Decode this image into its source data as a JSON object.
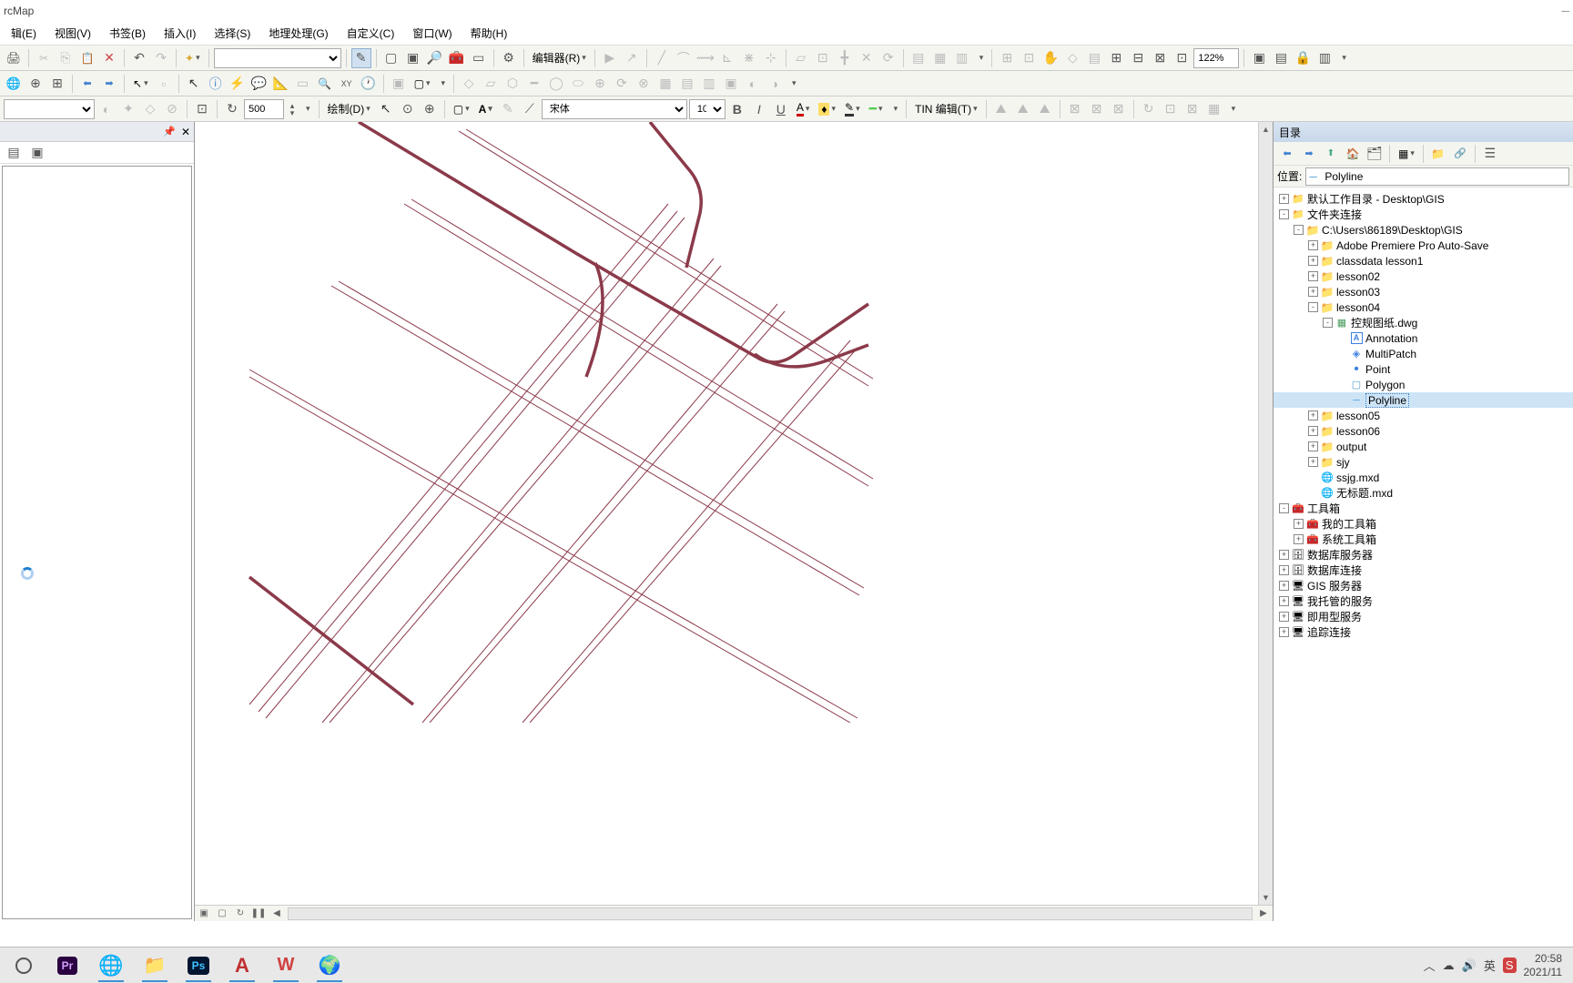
{
  "app_title": "rcMap",
  "menus": [
    "辑(E)",
    "视图(V)",
    "书签(B)",
    "插入(I)",
    "选择(S)",
    "地理处理(G)",
    "自定义(C)",
    "窗口(W)",
    "帮助(H)"
  ],
  "scale_value": "500",
  "draw_label": "绘制(D)",
  "editor_label": "编辑器(R)",
  "tin_label": "TIN 编辑(T)",
  "font_name": "宋体",
  "font_size": "10",
  "zoom_pct": "122%",
  "catalog": {
    "title": "目录",
    "location_label": "位置:",
    "location_value": "Polyline",
    "tree": [
      {
        "depth": 0,
        "toggle": "+",
        "icon": "home-folder",
        "label": "默认工作目录 - Desktop\\GIS"
      },
      {
        "depth": 0,
        "toggle": "-",
        "icon": "conn-folder",
        "label": "文件夹连接"
      },
      {
        "depth": 1,
        "toggle": "-",
        "icon": "folder-icon",
        "label": "C:\\Users\\86189\\Desktop\\GIS"
      },
      {
        "depth": 2,
        "toggle": "+",
        "icon": "folder-icon",
        "label": "Adobe Premiere Pro Auto-Save"
      },
      {
        "depth": 2,
        "toggle": "+",
        "icon": "folder-icon",
        "label": "classdata lesson1"
      },
      {
        "depth": 2,
        "toggle": "+",
        "icon": "folder-icon",
        "label": "lesson02"
      },
      {
        "depth": 2,
        "toggle": "+",
        "icon": "folder-icon",
        "label": "lesson03"
      },
      {
        "depth": 2,
        "toggle": "-",
        "icon": "folder-icon",
        "label": "lesson04"
      },
      {
        "depth": 3,
        "toggle": "-",
        "icon": "dwg-icon",
        "label": "控规图纸.dwg"
      },
      {
        "depth": 4,
        "toggle": "",
        "icon": "anno-icon",
        "label": "Annotation"
      },
      {
        "depth": 4,
        "toggle": "",
        "icon": "multi-icon",
        "label": "MultiPatch"
      },
      {
        "depth": 4,
        "toggle": "",
        "icon": "point-icon",
        "label": "Point"
      },
      {
        "depth": 4,
        "toggle": "",
        "icon": "poly-icon",
        "label": "Polygon"
      },
      {
        "depth": 4,
        "toggle": "",
        "icon": "line-icon",
        "label": "Polyline",
        "selected": true
      },
      {
        "depth": 2,
        "toggle": "+",
        "icon": "folder-icon",
        "label": "lesson05"
      },
      {
        "depth": 2,
        "toggle": "+",
        "icon": "folder-icon",
        "label": "lesson06"
      },
      {
        "depth": 2,
        "toggle": "+",
        "icon": "folder-icon",
        "label": "output"
      },
      {
        "depth": 2,
        "toggle": "+",
        "icon": "folder-icon",
        "label": "sjy"
      },
      {
        "depth": 2,
        "toggle": "",
        "icon": "mxd-icon",
        "label": "ssjg.mxd"
      },
      {
        "depth": 2,
        "toggle": "",
        "icon": "mxd-icon",
        "label": "无标题.mxd"
      },
      {
        "depth": 0,
        "toggle": "-",
        "icon": "toolbox-icon",
        "label": "工具箱"
      },
      {
        "depth": 1,
        "toggle": "+",
        "icon": "toolbox-icon",
        "label": "我的工具箱"
      },
      {
        "depth": 1,
        "toggle": "+",
        "icon": "toolbox-icon",
        "label": "系统工具箱"
      },
      {
        "depth": 0,
        "toggle": "+",
        "icon": "db-icon",
        "label": "数据库服务器"
      },
      {
        "depth": 0,
        "toggle": "+",
        "icon": "db-icon",
        "label": "数据库连接"
      },
      {
        "depth": 0,
        "toggle": "+",
        "icon": "server-icon",
        "label": "GIS 服务器"
      },
      {
        "depth": 0,
        "toggle": "+",
        "icon": "server-icon",
        "label": "我托管的服务"
      },
      {
        "depth": 0,
        "toggle": "+",
        "icon": "server-icon",
        "label": "即用型服务"
      },
      {
        "depth": 0,
        "toggle": "+",
        "icon": "server-icon",
        "label": "追踪连接"
      }
    ]
  },
  "taskbar": {
    "time": "20:58",
    "date": "2021/11"
  }
}
